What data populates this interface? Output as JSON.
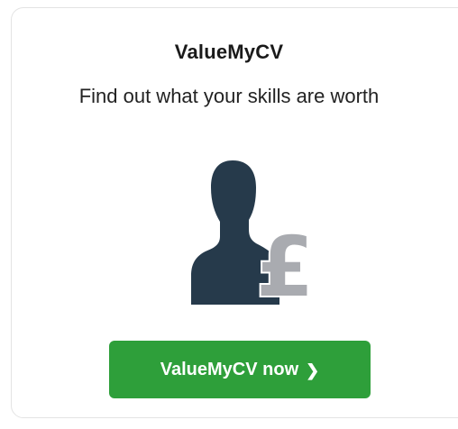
{
  "widget": {
    "title": "ValueMyCV",
    "tagline": "Find out what your skills are worth",
    "illustration": {
      "icon": "person-pound-icon",
      "person_color": "#263a4b",
      "pound_color": "#a9abb0"
    },
    "cta": {
      "label": "ValueMyCV now",
      "icon": "chevron-right-icon",
      "glyph": "❯",
      "color": "#2e9f3a"
    }
  }
}
